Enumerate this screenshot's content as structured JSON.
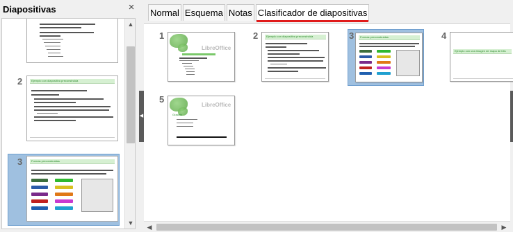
{
  "panel": {
    "title": "Diapositivas",
    "close_glyph": "×"
  },
  "left_slides": [
    {
      "number": "",
      "title": ""
    },
    {
      "number": "2",
      "title": "Ejemplo con diapositiva preconstruida"
    },
    {
      "number": "3",
      "title": "Formas preconstruidas"
    }
  ],
  "tabs": [
    {
      "label": "Normal"
    },
    {
      "label": "Esquema"
    },
    {
      "label": "Notas"
    },
    {
      "label": "Clasificador de diapositivas"
    }
  ],
  "active_tab": "Clasificador de diapositivas",
  "sorter_slides": [
    {
      "number": "1",
      "title": "",
      "logo": "LibreOffice"
    },
    {
      "number": "2",
      "title": "Ejemplo con diapositiva preconstruida"
    },
    {
      "number": "3",
      "title": "Formas preconstruidas"
    },
    {
      "number": "4",
      "title": "Ejemplo con una imagen de mapa de bits"
    },
    {
      "number": "5",
      "title": "Gracias",
      "logo": "LibreOffice"
    }
  ],
  "selected_slide": "3",
  "icons": {
    "close": "close-icon",
    "scroll_up": "chevron-up-icon",
    "scroll_down": "chevron-down-icon",
    "scroll_left": "chevron-left-icon",
    "scroll_right": "chevron-right-icon",
    "collapse": "collapse-left-icon"
  },
  "colors": {
    "accent_red": "#e01b1b",
    "selection_blue": "#9fc0e0",
    "slide_title_green": "#2a8a2a"
  }
}
